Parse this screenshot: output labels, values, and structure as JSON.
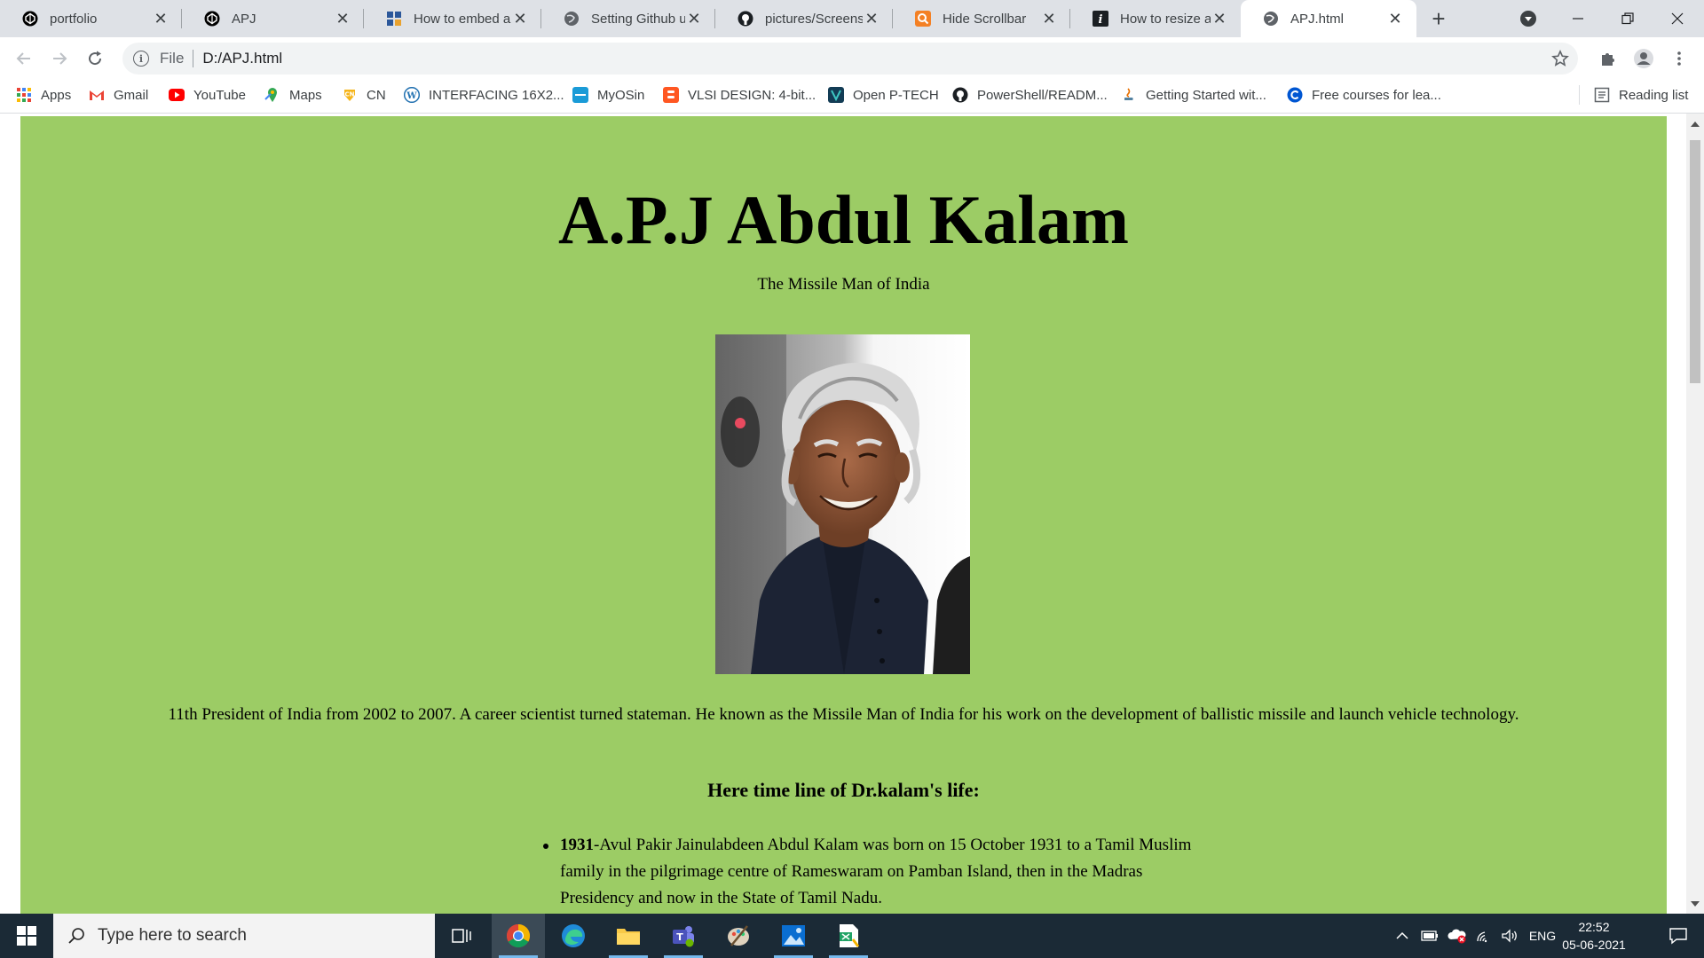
{
  "browser": {
    "tabs": [
      {
        "title": "portfolio",
        "icon": "codepen-icon"
      },
      {
        "title": "APJ",
        "icon": "codepen-icon"
      },
      {
        "title": "How to embed an",
        "icon": "grid-icon"
      },
      {
        "title": "Setting Github up",
        "icon": "globe-icon"
      },
      {
        "title": "pictures/Screensh",
        "icon": "github-icon"
      },
      {
        "title": "Hide Scrollbar",
        "icon": "search-icon"
      },
      {
        "title": "How to resize an",
        "icon": "info-icon"
      },
      {
        "title": "APJ.html",
        "icon": "globe-icon",
        "active": true
      }
    ],
    "address": {
      "scheme": "File",
      "url": "D:/APJ.html"
    },
    "bookmarks": [
      {
        "label": "Apps",
        "icon": "apps-grid-icon"
      },
      {
        "label": "Gmail",
        "icon": "gmail-icon"
      },
      {
        "label": "YouTube",
        "icon": "youtube-icon"
      },
      {
        "label": "Maps",
        "icon": "maps-icon"
      },
      {
        "label": "CN",
        "icon": "cn-icon"
      },
      {
        "label": "INTERFACING 16X2...",
        "icon": "wordpress-icon"
      },
      {
        "label": "MyOSin",
        "icon": "myosin-icon"
      },
      {
        "label": "VLSI DESIGN: 4-bit...",
        "icon": "blogger-icon"
      },
      {
        "label": "Open P-TECH",
        "icon": "ptech-icon"
      },
      {
        "label": "PowerShell/READM...",
        "icon": "github-icon"
      },
      {
        "label": "Getting Started wit...",
        "icon": "java-icon"
      },
      {
        "label": "Free courses for lea...",
        "icon": "coursera-icon"
      }
    ],
    "reading_list": "Reading list"
  },
  "page": {
    "heading": "A.P.J Abdul Kalam",
    "tagline": "The Missile Man of India",
    "bio": "11th President of India from 2002 to 2007. A career scientist turned stateman. He known as the Missile Man of India for his work on the development of ballistic missile and launch vehicle technology.",
    "timeline_heading": "Here time line of Dr.kalam's life:",
    "timeline": [
      {
        "year": "1931",
        "text": "-Avul Pakir Jainulabdeen Abdul Kalam was born on 15 October 1931 to a Tamil Muslim family in the pilgrimage centre of Rameswaram on Pamban Island, then in the Madras Presidency and now in the State of Tamil Nadu."
      }
    ],
    "bg_color": "#9ccc65"
  },
  "taskbar": {
    "search_placeholder": "Type here to search",
    "language": "ENG",
    "time": "22:52",
    "date": "05-06-2021"
  }
}
